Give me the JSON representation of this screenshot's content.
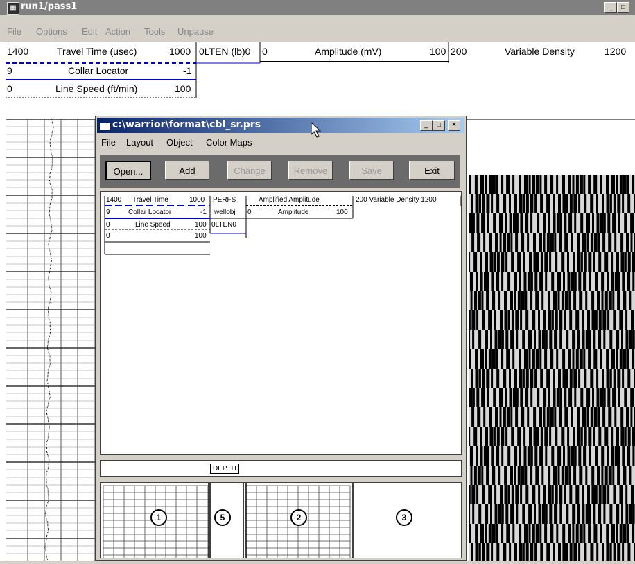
{
  "main_window": {
    "title": "run1/pass1",
    "app_icon": "grid-app-icon",
    "controls": {
      "minimize": "_",
      "restore": "□"
    },
    "menu": [
      "File",
      "Options",
      "Edit",
      "Action",
      "Tools",
      "Unpause"
    ]
  },
  "header": {
    "travel_time": {
      "min": "1400",
      "label": "Travel Time (usec)",
      "max": "1000"
    },
    "olten": "0LTEN (lb)0",
    "amplitude": {
      "min": "0",
      "label": "Amplitude (mV)",
      "max": "100"
    },
    "variable_density": {
      "min": "200",
      "label": "Variable Density",
      "max": "1200"
    },
    "collar_locator": {
      "min": "9",
      "label": "Collar Locator",
      "max": "-1"
    },
    "line_speed": {
      "min": "0",
      "label": "Line Speed (ft/min)",
      "max": "100"
    }
  },
  "dialog": {
    "title": "c:\\warrior\\format\\cbl_sr.prs",
    "controls": {
      "minimize": "_",
      "maximize": "□",
      "close": "×"
    },
    "menu": [
      "File",
      "Layout",
      "Object",
      "Color Maps"
    ],
    "toolbar": {
      "open": "Open...",
      "add": "Add",
      "change": "Change",
      "remove": "Remove",
      "save": "Save",
      "exit": "Exit"
    },
    "layout": {
      "travel_time": {
        "min": "1400",
        "label": "Travel Time",
        "max": "1000"
      },
      "collar_locator": {
        "min": "9",
        "label": "Collar Locator",
        "max": "-1"
      },
      "line_speed": {
        "min": "0",
        "label": "Line Speed",
        "max": "100"
      },
      "blank_row": {
        "min": "0",
        "max": "100"
      },
      "perfs": "PERFS",
      "wellobj": "wellobj",
      "olten": "0LTEN0",
      "amplified_amplitude": "Amplified Amplitude",
      "amplitude": {
        "min": "0",
        "label": "Amplitude",
        "max": "100"
      },
      "variable_density": "200  Variable Density  1200"
    },
    "depth_label": "DEPTH",
    "tracks": [
      "1",
      "5",
      "2",
      "3"
    ]
  },
  "colors": {
    "title_active": "#0a246a",
    "title_inactive": "#808080",
    "blue_curve": "#0000cc",
    "face": "#d4d0c8"
  }
}
